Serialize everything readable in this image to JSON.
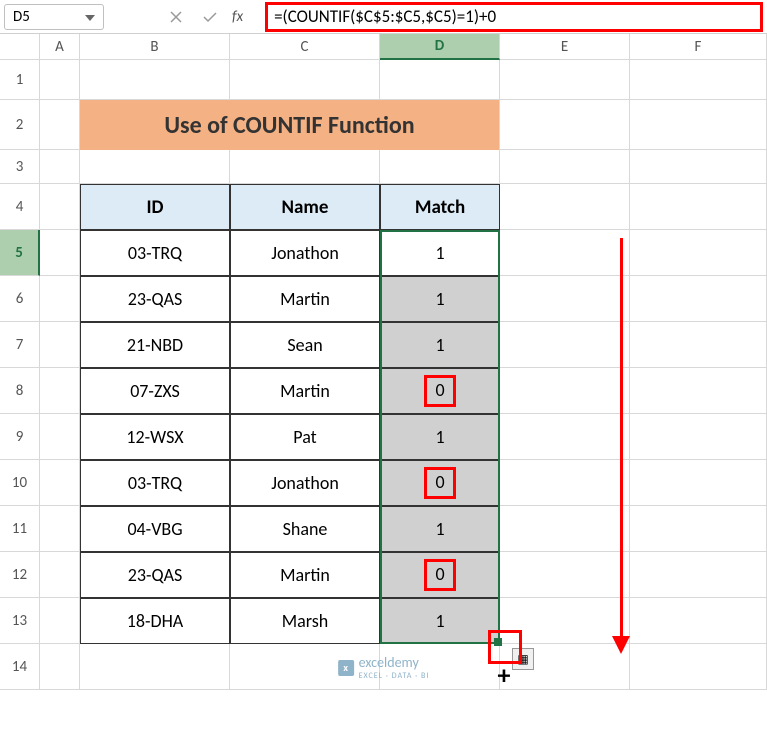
{
  "name_box": "D5",
  "formula": "=(COUNTIF($C$5:$C5,$C5)=1)+0",
  "columns": [
    "A",
    "B",
    "C",
    "D",
    "E",
    "F"
  ],
  "rows": [
    "1",
    "2",
    "3",
    "4",
    "5",
    "6",
    "7",
    "8",
    "9",
    "10",
    "11",
    "12",
    "13",
    "14"
  ],
  "active_col": "D",
  "active_row": "5",
  "title": "Use of COUNTIF Function",
  "headers": {
    "id": "ID",
    "name": "Name",
    "match": "Match"
  },
  "data": [
    {
      "id": "03-TRQ",
      "name": "Jonathon",
      "match": "1",
      "boxed": false
    },
    {
      "id": "23-QAS",
      "name": "Martin",
      "match": "1",
      "boxed": false
    },
    {
      "id": "21-NBD",
      "name": "Sean",
      "match": "1",
      "boxed": false
    },
    {
      "id": "07-ZXS",
      "name": "Martin",
      "match": "0",
      "boxed": true
    },
    {
      "id": "12-WSX",
      "name": "Pat",
      "match": "1",
      "boxed": false
    },
    {
      "id": "03-TRQ",
      "name": "Jonathon",
      "match": "0",
      "boxed": true
    },
    {
      "id": "04-VBG",
      "name": "Shane",
      "match": "1",
      "boxed": false
    },
    {
      "id": "23-QAS",
      "name": "Martin",
      "match": "0",
      "boxed": true
    },
    {
      "id": "18-DHA",
      "name": "Marsh",
      "match": "1",
      "boxed": false
    }
  ],
  "watermark": {
    "name": "exceldemy",
    "sub": "EXCEL · DATA · BI"
  }
}
